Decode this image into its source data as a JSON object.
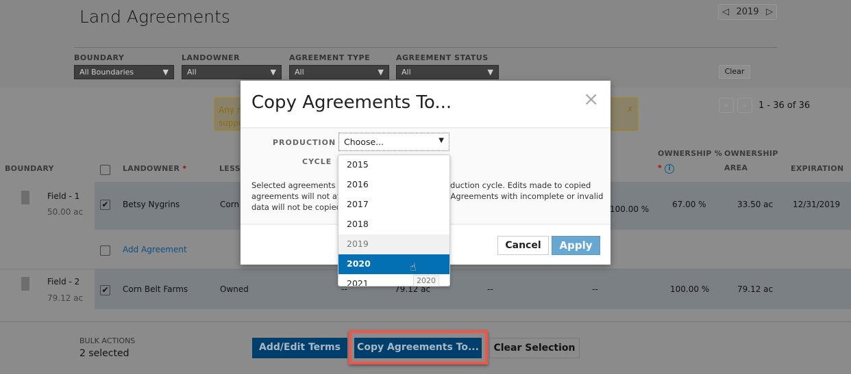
{
  "header": {
    "title": "Land Agreements",
    "year": "2019",
    "prev_icon": "triangle-left",
    "next_icon": "triangle-right"
  },
  "filters": [
    {
      "label": "BOUNDARY",
      "value": "All Boundaries"
    },
    {
      "label": "LANDOWNER",
      "value": "All"
    },
    {
      "label": "AGREEMENT TYPE",
      "value": "All"
    },
    {
      "label": "AGREEMENT STATUS",
      "value": "All"
    }
  ],
  "clear_label": "Clear",
  "notice": {
    "line1": "Any n",
    "line2": "suppo",
    "close": "x",
    "color": "#8a6d10"
  },
  "pagination": {
    "prev": "«",
    "next": "»",
    "text": "1 - 36 of 36"
  },
  "table": {
    "headers": {
      "boundary": "BOUNDARY",
      "landowner": "LANDOWNER",
      "required": "*",
      "lessee": "LESSE",
      "ownership_pct_1": "OWNERSHIP %",
      "ownership_pct_2": "*",
      "ownership_area_1": "OWNERSHIP",
      "ownership_area_2": "AREA",
      "expiration": "EXPIRATION"
    },
    "rows": [
      {
        "field": "Field - 1",
        "area": "50.00 ac",
        "checked": true,
        "landowner": "Betsy Nygrins",
        "lessee": "Corn",
        "share": "100.00 %",
        "ownership_pct": "67.00 %",
        "ownership_area": "33.50 ac",
        "expiration": "12/31/2019"
      },
      {
        "field": "Field - 2",
        "area": "79.12 ac",
        "checked": true,
        "landowner": "Corn Belt Farms",
        "lessee": "Owned",
        "c1": "--",
        "c2": "79.12 ac",
        "c3": "--",
        "c4": "--",
        "ownership_pct": "100.00 %",
        "ownership_area": "79.12 ac",
        "expiration": ""
      }
    ],
    "add_agreement": "Add Agreement"
  },
  "bulk": {
    "label": "BULK ACTIONS",
    "count": "2 selected",
    "add_edit": "Add/Edit Terms",
    "copy": "Copy Agreements To...",
    "clear": "Clear Selection",
    "accent": "#003f6b",
    "highlight": "#f0554a"
  },
  "dialog": {
    "title": "Copy Agreements To...",
    "close": "×",
    "production_label": "PRODUCTION",
    "cycle_label": "CYCLE",
    "select_value": "Choose...",
    "desc_left": [
      "Selected agreements wi",
      "agreements will not affe",
      "data will not be copied."
    ],
    "desc_right": [
      "oduction cycle. Edits made to copied",
      ": Agreements with incomplete or invalid"
    ],
    "cancel": "Cancel",
    "apply": "Apply",
    "options": [
      "2015",
      "2016",
      "2017",
      "2018",
      "2019",
      "2020",
      "2021"
    ],
    "current": "2019",
    "selected": "2020",
    "tooltip": "2020"
  }
}
